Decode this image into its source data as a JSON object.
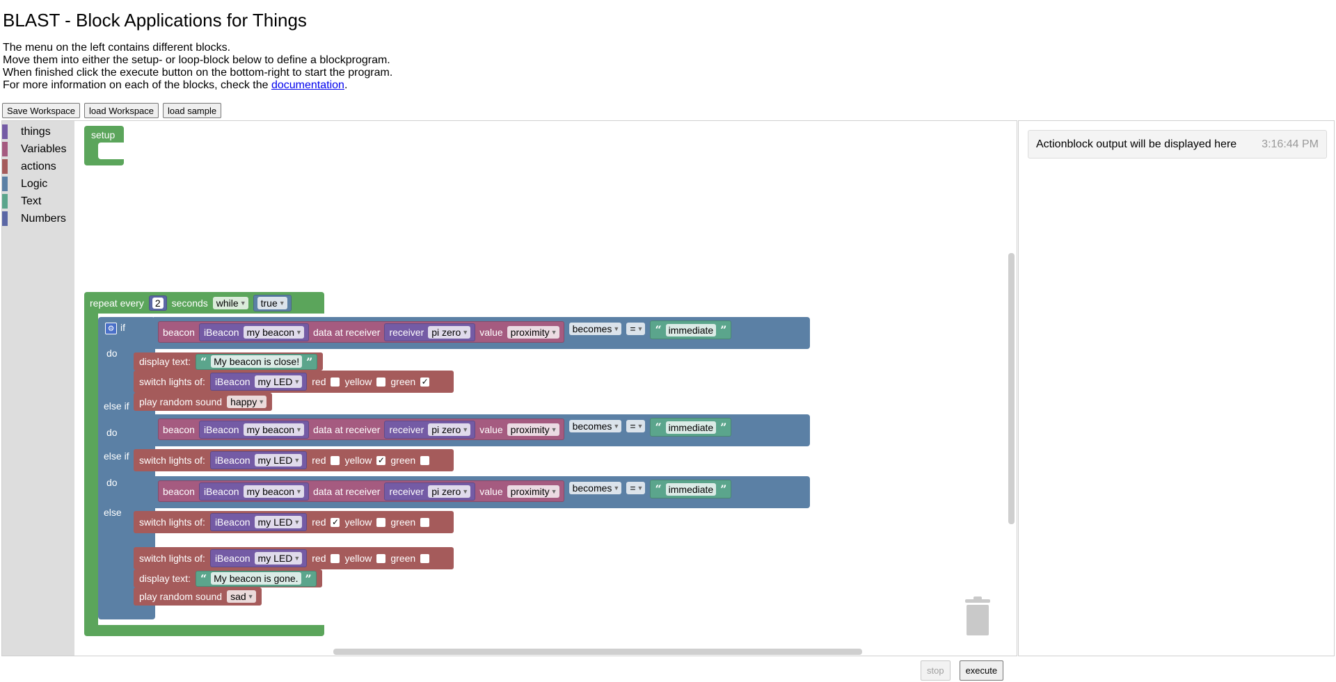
{
  "title": "BLAST - Block Applications for Things",
  "intro": {
    "line1": "The menu on the left contains different blocks.",
    "line2": "Move them into either the setup- or loop-block below to define a blockprogram.",
    "line3": "When finished click the execute button on the bottom-right to start the program.",
    "line4_prefix": "For more information on each of the blocks, check the ",
    "line4_link": "documentation",
    "line4_suffix": "."
  },
  "buttons": {
    "save": "Save Workspace",
    "load": "load Workspace",
    "sample": "load sample",
    "stop": "stop",
    "execute": "execute"
  },
  "toolbox": [
    {
      "label": "things",
      "color": "#745ba5"
    },
    {
      "label": "Variables",
      "color": "#a55b80"
    },
    {
      "label": "actions",
      "color": "#a55b5b"
    },
    {
      "label": "Logic",
      "color": "#5b80a5"
    },
    {
      "label": "Text",
      "color": "#5ba58c"
    },
    {
      "label": "Numbers",
      "color": "#5b67a5"
    }
  ],
  "output": {
    "message": "Actionblock output will be displayed here",
    "time": "3:16:44 PM"
  },
  "blocks": {
    "setup": "setup",
    "repeat": {
      "prefix": "repeat every",
      "interval": "2",
      "seconds": "seconds",
      "mode": "while",
      "cond": "true"
    },
    "kw": {
      "if": "if",
      "do": "do",
      "elseif": "else if",
      "else": "else",
      "beacon": "beacon",
      "ibeacon": "iBeacon",
      "data_at": "data at receiver",
      "receiver": "receiver",
      "value": "value",
      "display": "display text:",
      "switch": "switch lights of:",
      "red": "red",
      "yellow": "yellow",
      "green": "green",
      "play": "play random sound",
      "becomes": "becomes",
      "eq": "="
    },
    "beacon_name": "my beacon",
    "receiver_name": "pi zero",
    "value_name": "proximity",
    "compare_text": "immediate",
    "led_name": "my LED",
    "text_close": "My beacon is close!",
    "text_gone": "My beacon is gone.",
    "sound_happy": "happy",
    "sound_sad": "sad",
    "checked": "✓"
  }
}
